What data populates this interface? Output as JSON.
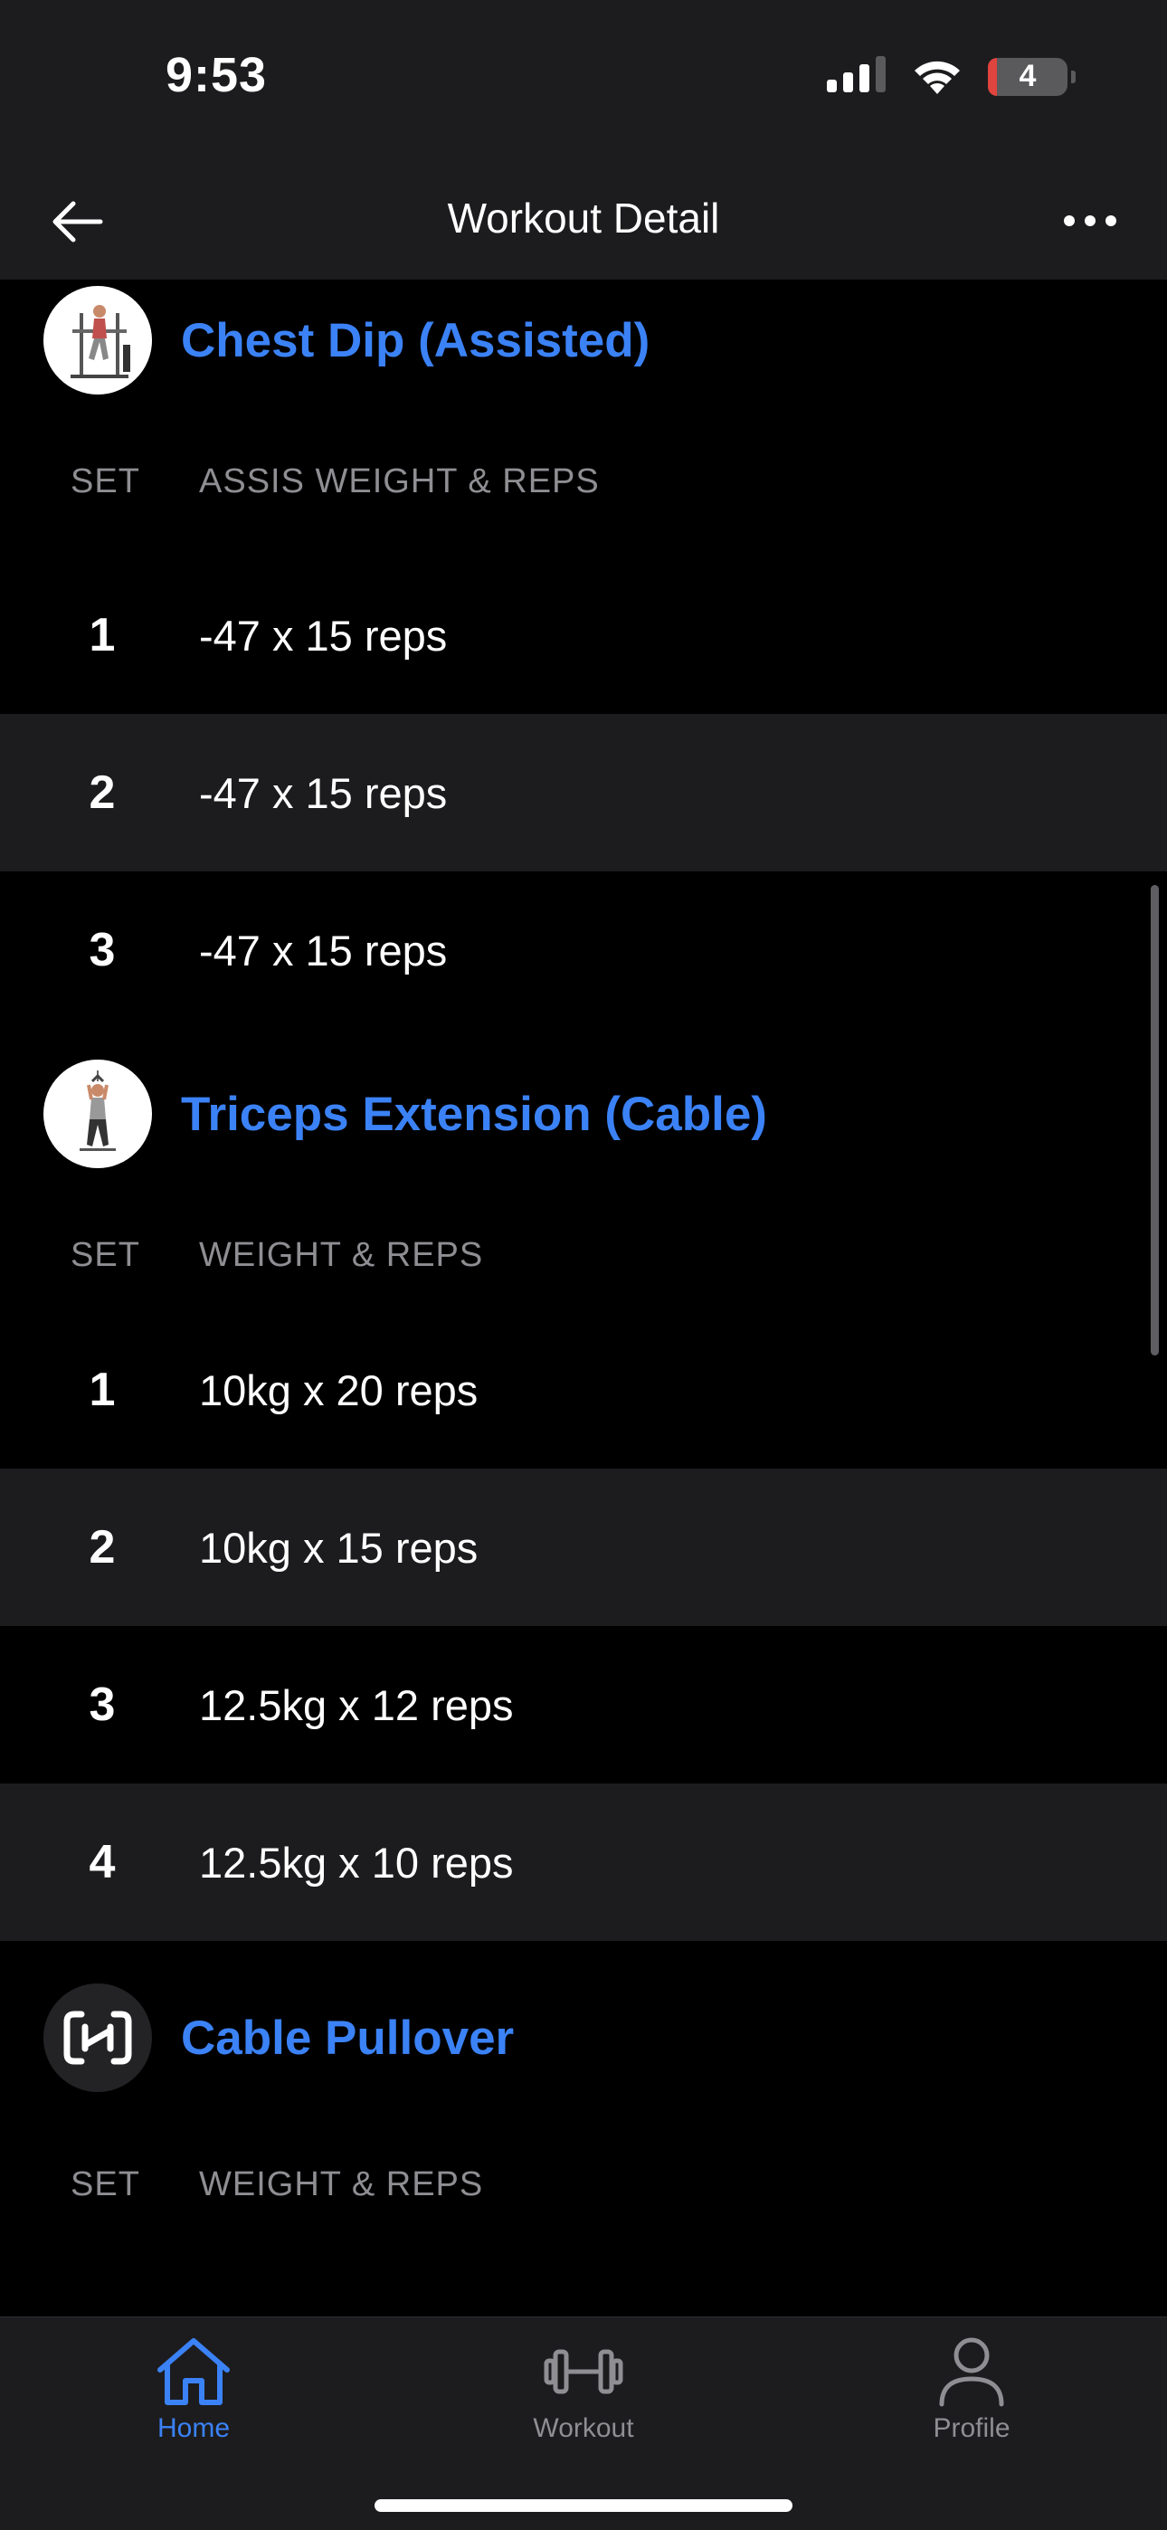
{
  "status_bar": {
    "time": "9:53",
    "battery_level": "4"
  },
  "nav": {
    "title": "Workout Detail"
  },
  "exercises": [
    {
      "name": "Chest Dip (Assisted)",
      "column_set": "SET",
      "column_value": "ASSIS WEIGHT & REPS",
      "sets": [
        {
          "num": "1",
          "value": "-47 x 15 reps"
        },
        {
          "num": "2",
          "value": "-47 x 15 reps"
        },
        {
          "num": "3",
          "value": "-47 x 15 reps"
        }
      ]
    },
    {
      "name": "Triceps Extension (Cable)",
      "column_set": "SET",
      "column_value": "WEIGHT & REPS",
      "sets": [
        {
          "num": "1",
          "value": "10kg x 20 reps"
        },
        {
          "num": "2",
          "value": "10kg x 15 reps"
        },
        {
          "num": "3",
          "value": "12.5kg x 12 reps"
        },
        {
          "num": "4",
          "value": "12.5kg x 10 reps"
        }
      ]
    },
    {
      "name": "Cable Pullover",
      "column_set": "SET",
      "column_value": "WEIGHT & REPS",
      "sets": []
    }
  ],
  "tabs": [
    {
      "label": "Home",
      "icon": "home-icon",
      "active": true
    },
    {
      "label": "Workout",
      "icon": "dumbbell-icon",
      "active": false
    },
    {
      "label": "Profile",
      "icon": "person-icon",
      "active": false
    }
  ],
  "colors": {
    "accent": "#3b82f6",
    "background": "#000000",
    "surface": "#1c1c1e",
    "muted": "#8e8e93"
  }
}
